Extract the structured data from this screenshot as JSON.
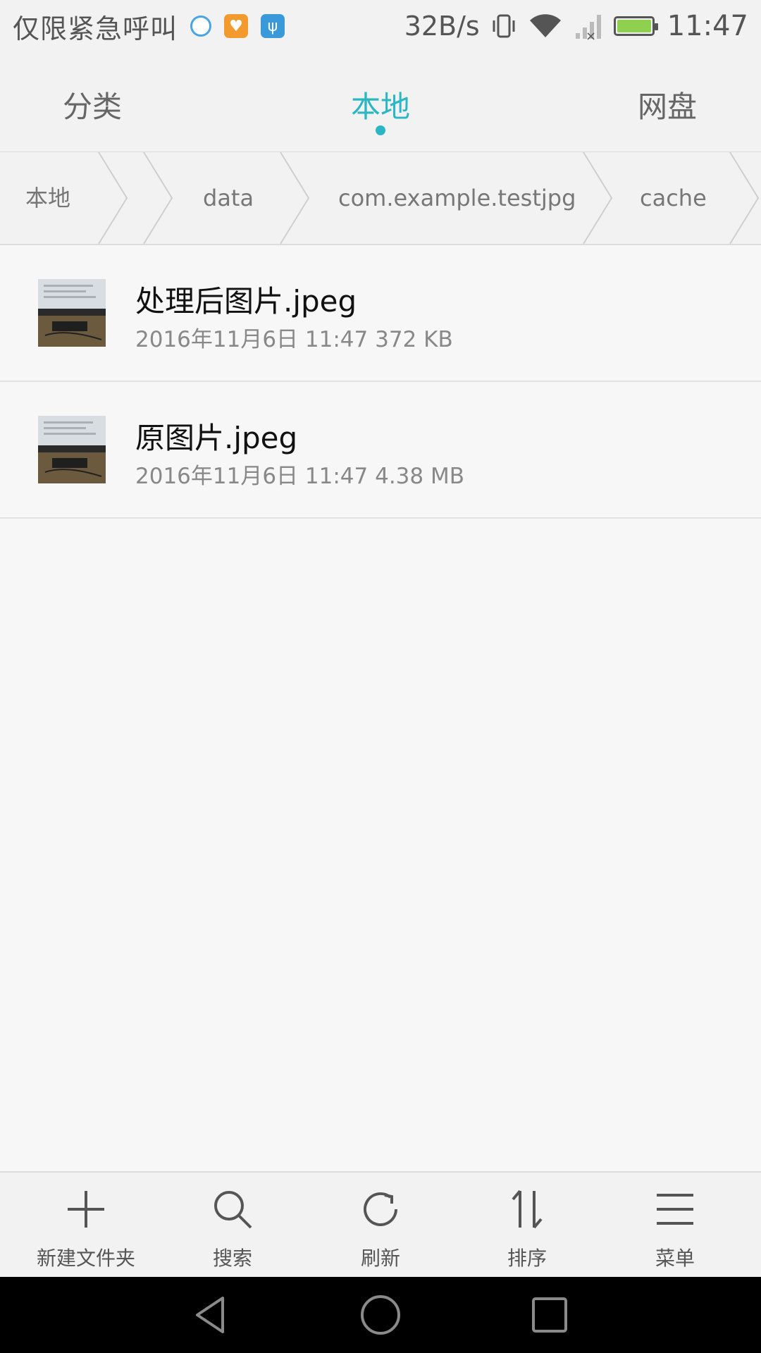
{
  "status_bar": {
    "carrier_text": "仅限紧急呼叫",
    "net_speed": "32B/s",
    "time": "11:47",
    "notification_icons": [
      "browser-icon",
      "health-app-icon",
      "usb-icon"
    ],
    "battery_color": "#8fd14f"
  },
  "tabs": [
    {
      "label": "分类",
      "active": false
    },
    {
      "label": "本地",
      "active": true
    },
    {
      "label": "网盘",
      "active": false
    }
  ],
  "accent_color": "#2ab6c4",
  "breadcrumb": [
    "本地",
    "",
    "data",
    "com.example.testjpg",
    "cache"
  ],
  "files": [
    {
      "name": "处理后图片.jpeg",
      "meta": "2016年11月6日 11:47 372 KB"
    },
    {
      "name": "原图片.jpeg",
      "meta": "2016年11月6日 11:47 4.38 MB"
    }
  ],
  "toolbar": [
    {
      "label": "新建文件夹",
      "icon": "plus-icon"
    },
    {
      "label": "搜索",
      "icon": "search-icon"
    },
    {
      "label": "刷新",
      "icon": "refresh-icon"
    },
    {
      "label": "排序",
      "icon": "sort-icon"
    },
    {
      "label": "菜单",
      "icon": "menu-icon"
    }
  ],
  "nav": [
    "back-icon",
    "home-icon",
    "recents-icon"
  ]
}
